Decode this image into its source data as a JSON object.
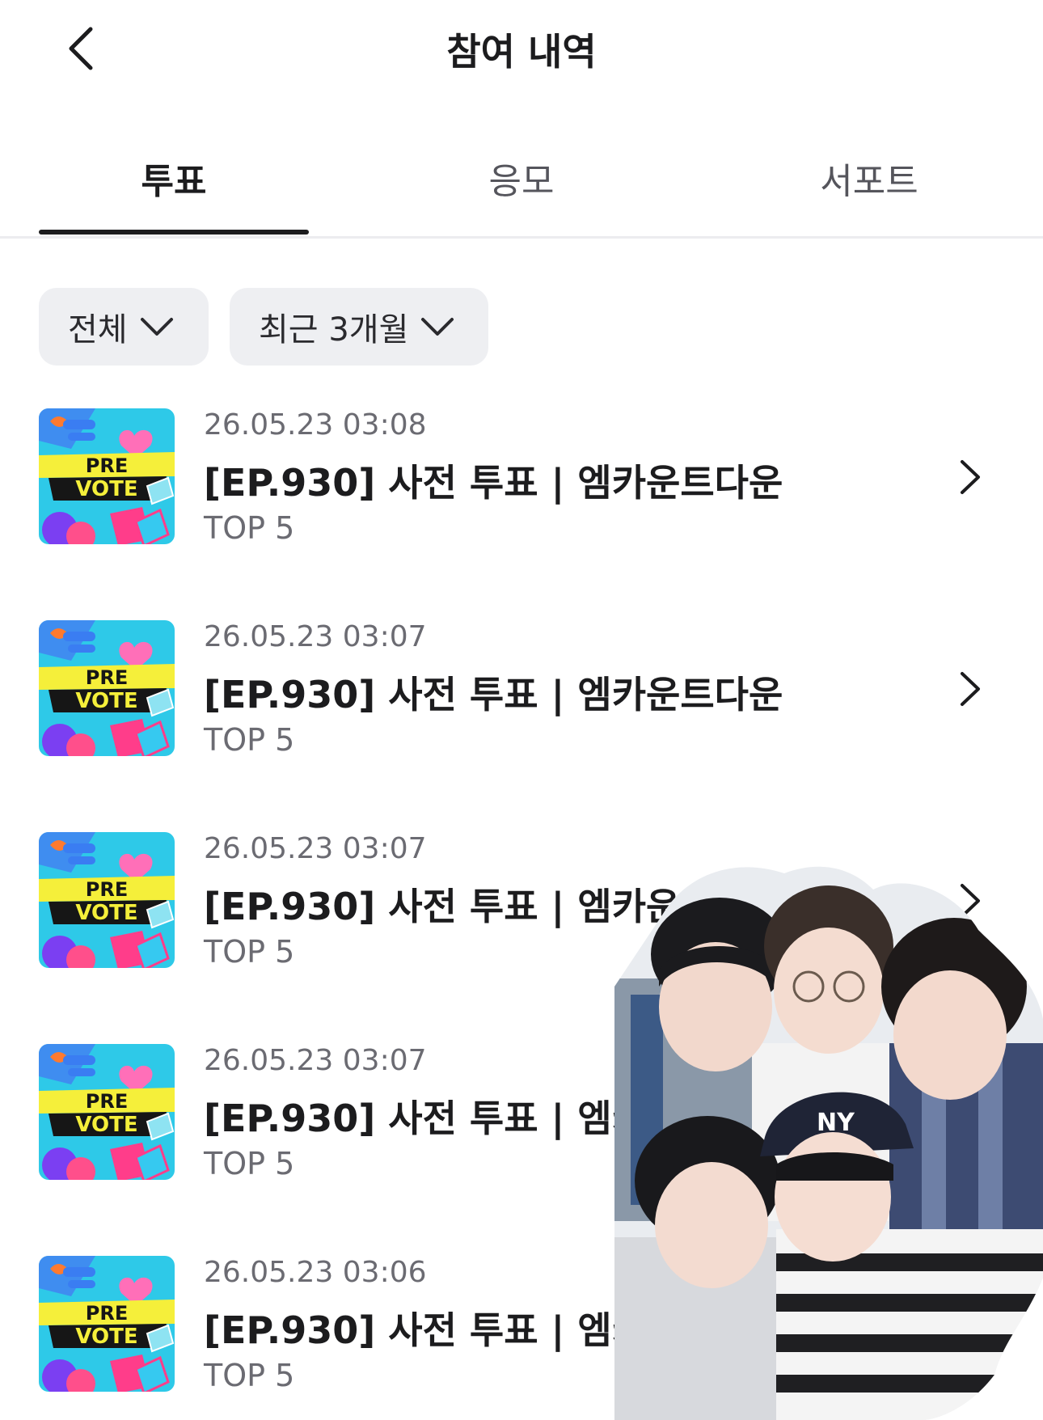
{
  "header": {
    "title": "참여 내역",
    "back_icon": "chevron-left-icon"
  },
  "tabs": [
    {
      "label": "투표",
      "active": true
    },
    {
      "label": "응모",
      "active": false
    },
    {
      "label": "서포트",
      "active": false
    }
  ],
  "filters": [
    {
      "label": "전체",
      "icon": "chevron-down-icon"
    },
    {
      "label": "최근 3개월",
      "icon": "chevron-down-icon"
    }
  ],
  "items": [
    {
      "date": "26.05.23 03:08",
      "title": "[EP.930] 사전 투표 | 엠카운트다운",
      "rank": "TOP 5",
      "thumb": {
        "line1": "PRE",
        "line2": "VOTE"
      }
    },
    {
      "date": "26.05.23 03:07",
      "title": "[EP.930] 사전 투표 | 엠카운트다운",
      "rank": "TOP 5",
      "thumb": {
        "line1": "PRE",
        "line2": "VOTE"
      }
    },
    {
      "date": "26.05.23 03:07",
      "title": "[EP.930] 사전 투표 | 엠카운트다운",
      "rank": "TOP 5",
      "thumb": {
        "line1": "PRE",
        "line2": "VOTE"
      }
    },
    {
      "date": "26.05.23 03:07",
      "title": "[EP.930] 사전 투표 | 엠카운트다운",
      "rank": "TOP 5",
      "thumb": {
        "line1": "PRE",
        "line2": "VOTE"
      }
    },
    {
      "date": "26.05.23 03:06",
      "title": "[EP.930] 사전 투표 | 엠카운트다운",
      "rank": "TOP 5",
      "thumb": {
        "line1": "PRE",
        "line2": "VOTE"
      }
    }
  ],
  "overlay": {
    "description_icon": "group-photo-sticker-icon",
    "cap_text": "NY"
  },
  "colors": {
    "text_primary": "#1c1c1e",
    "text_secondary": "#6b6b72",
    "chip_bg": "#eeeff2",
    "thumb_bg": "#2ec9e8",
    "thumb_band": "#f5ef3a"
  }
}
